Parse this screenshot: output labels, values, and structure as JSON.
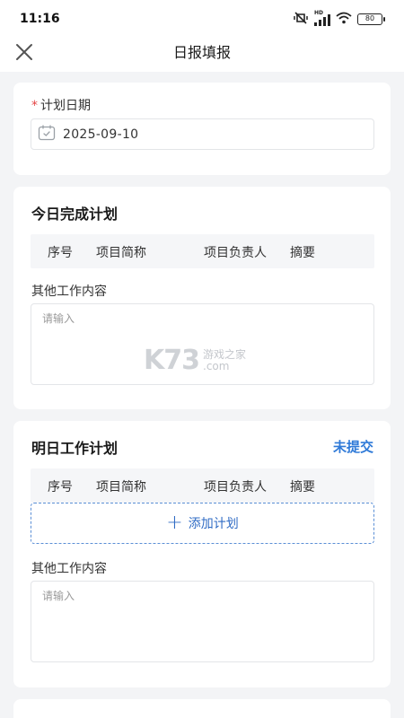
{
  "status_bar": {
    "time": "11:16",
    "battery": "80",
    "network": "HD"
  },
  "nav": {
    "title": "日报填报"
  },
  "date_section": {
    "label": "计划日期",
    "required_mark": "*",
    "value": "2025-09-10"
  },
  "today_section": {
    "title": "今日完成计划",
    "columns": [
      "序号",
      "项目简称",
      "项目负责人",
      "摘要"
    ],
    "other_label": "其他工作内容",
    "placeholder": "请输入"
  },
  "tomorrow_section": {
    "title": "明日工作计划",
    "status": "未提交",
    "columns": [
      "序号",
      "项目简称",
      "项目负责人",
      "摘要"
    ],
    "add_button": "添加计划",
    "other_label": "其他工作内容",
    "placeholder": "请输入"
  },
  "watermark": {
    "brand": "K73",
    "line1": "游戏之家",
    "line2": ".com"
  },
  "colors": {
    "accent": "#2f7ad8",
    "required": "#e54545",
    "background": "#f3f4f6"
  }
}
